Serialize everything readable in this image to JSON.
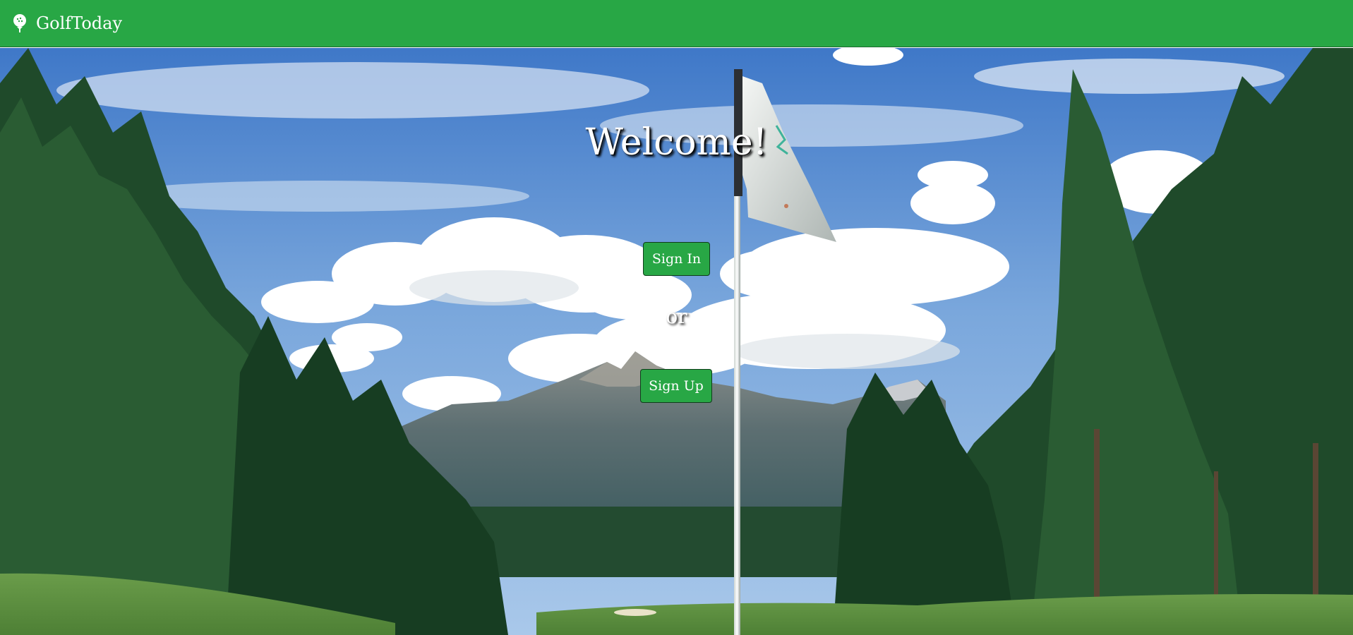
{
  "navbar": {
    "brand_name": "GolfToday",
    "brand_icon": "golf-ball-on-tee-icon",
    "background_color": "#28a745"
  },
  "hero": {
    "welcome_text": "Welcome!",
    "sign_in_label": "Sign In",
    "or_text": "or",
    "sign_up_label": "Sign Up",
    "button_color": "#28a745"
  }
}
